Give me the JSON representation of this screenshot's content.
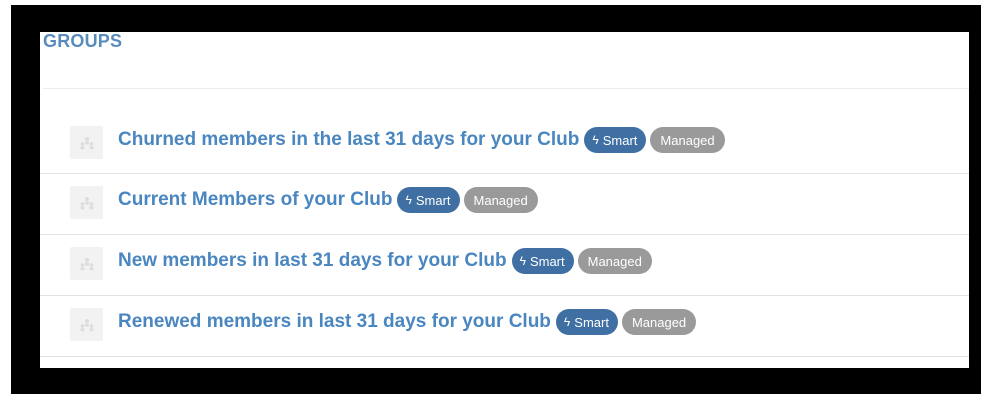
{
  "section": {
    "title": "GROUPS"
  },
  "groups": [
    {
      "name": "Churned members in the last 31 days for your Club",
      "smart_label": "Smart",
      "managed_label": "Managed"
    },
    {
      "name": "Current Members of your Club",
      "smart_label": "Smart",
      "managed_label": "Managed"
    },
    {
      "name": "New members in last 31 days for your Club",
      "smart_label": "Smart",
      "managed_label": "Managed"
    },
    {
      "name": "Renewed members in last 31 days for your Club",
      "smart_label": "Smart",
      "managed_label": "Managed"
    }
  ],
  "icons": {
    "group": "group-icon",
    "smart": "lightning-bolt-icon"
  },
  "colors": {
    "title": "#5a8bbd",
    "link": "#4a86bf",
    "smart_badge": "#3f6fa3",
    "managed_badge": "#9a9a9a"
  }
}
